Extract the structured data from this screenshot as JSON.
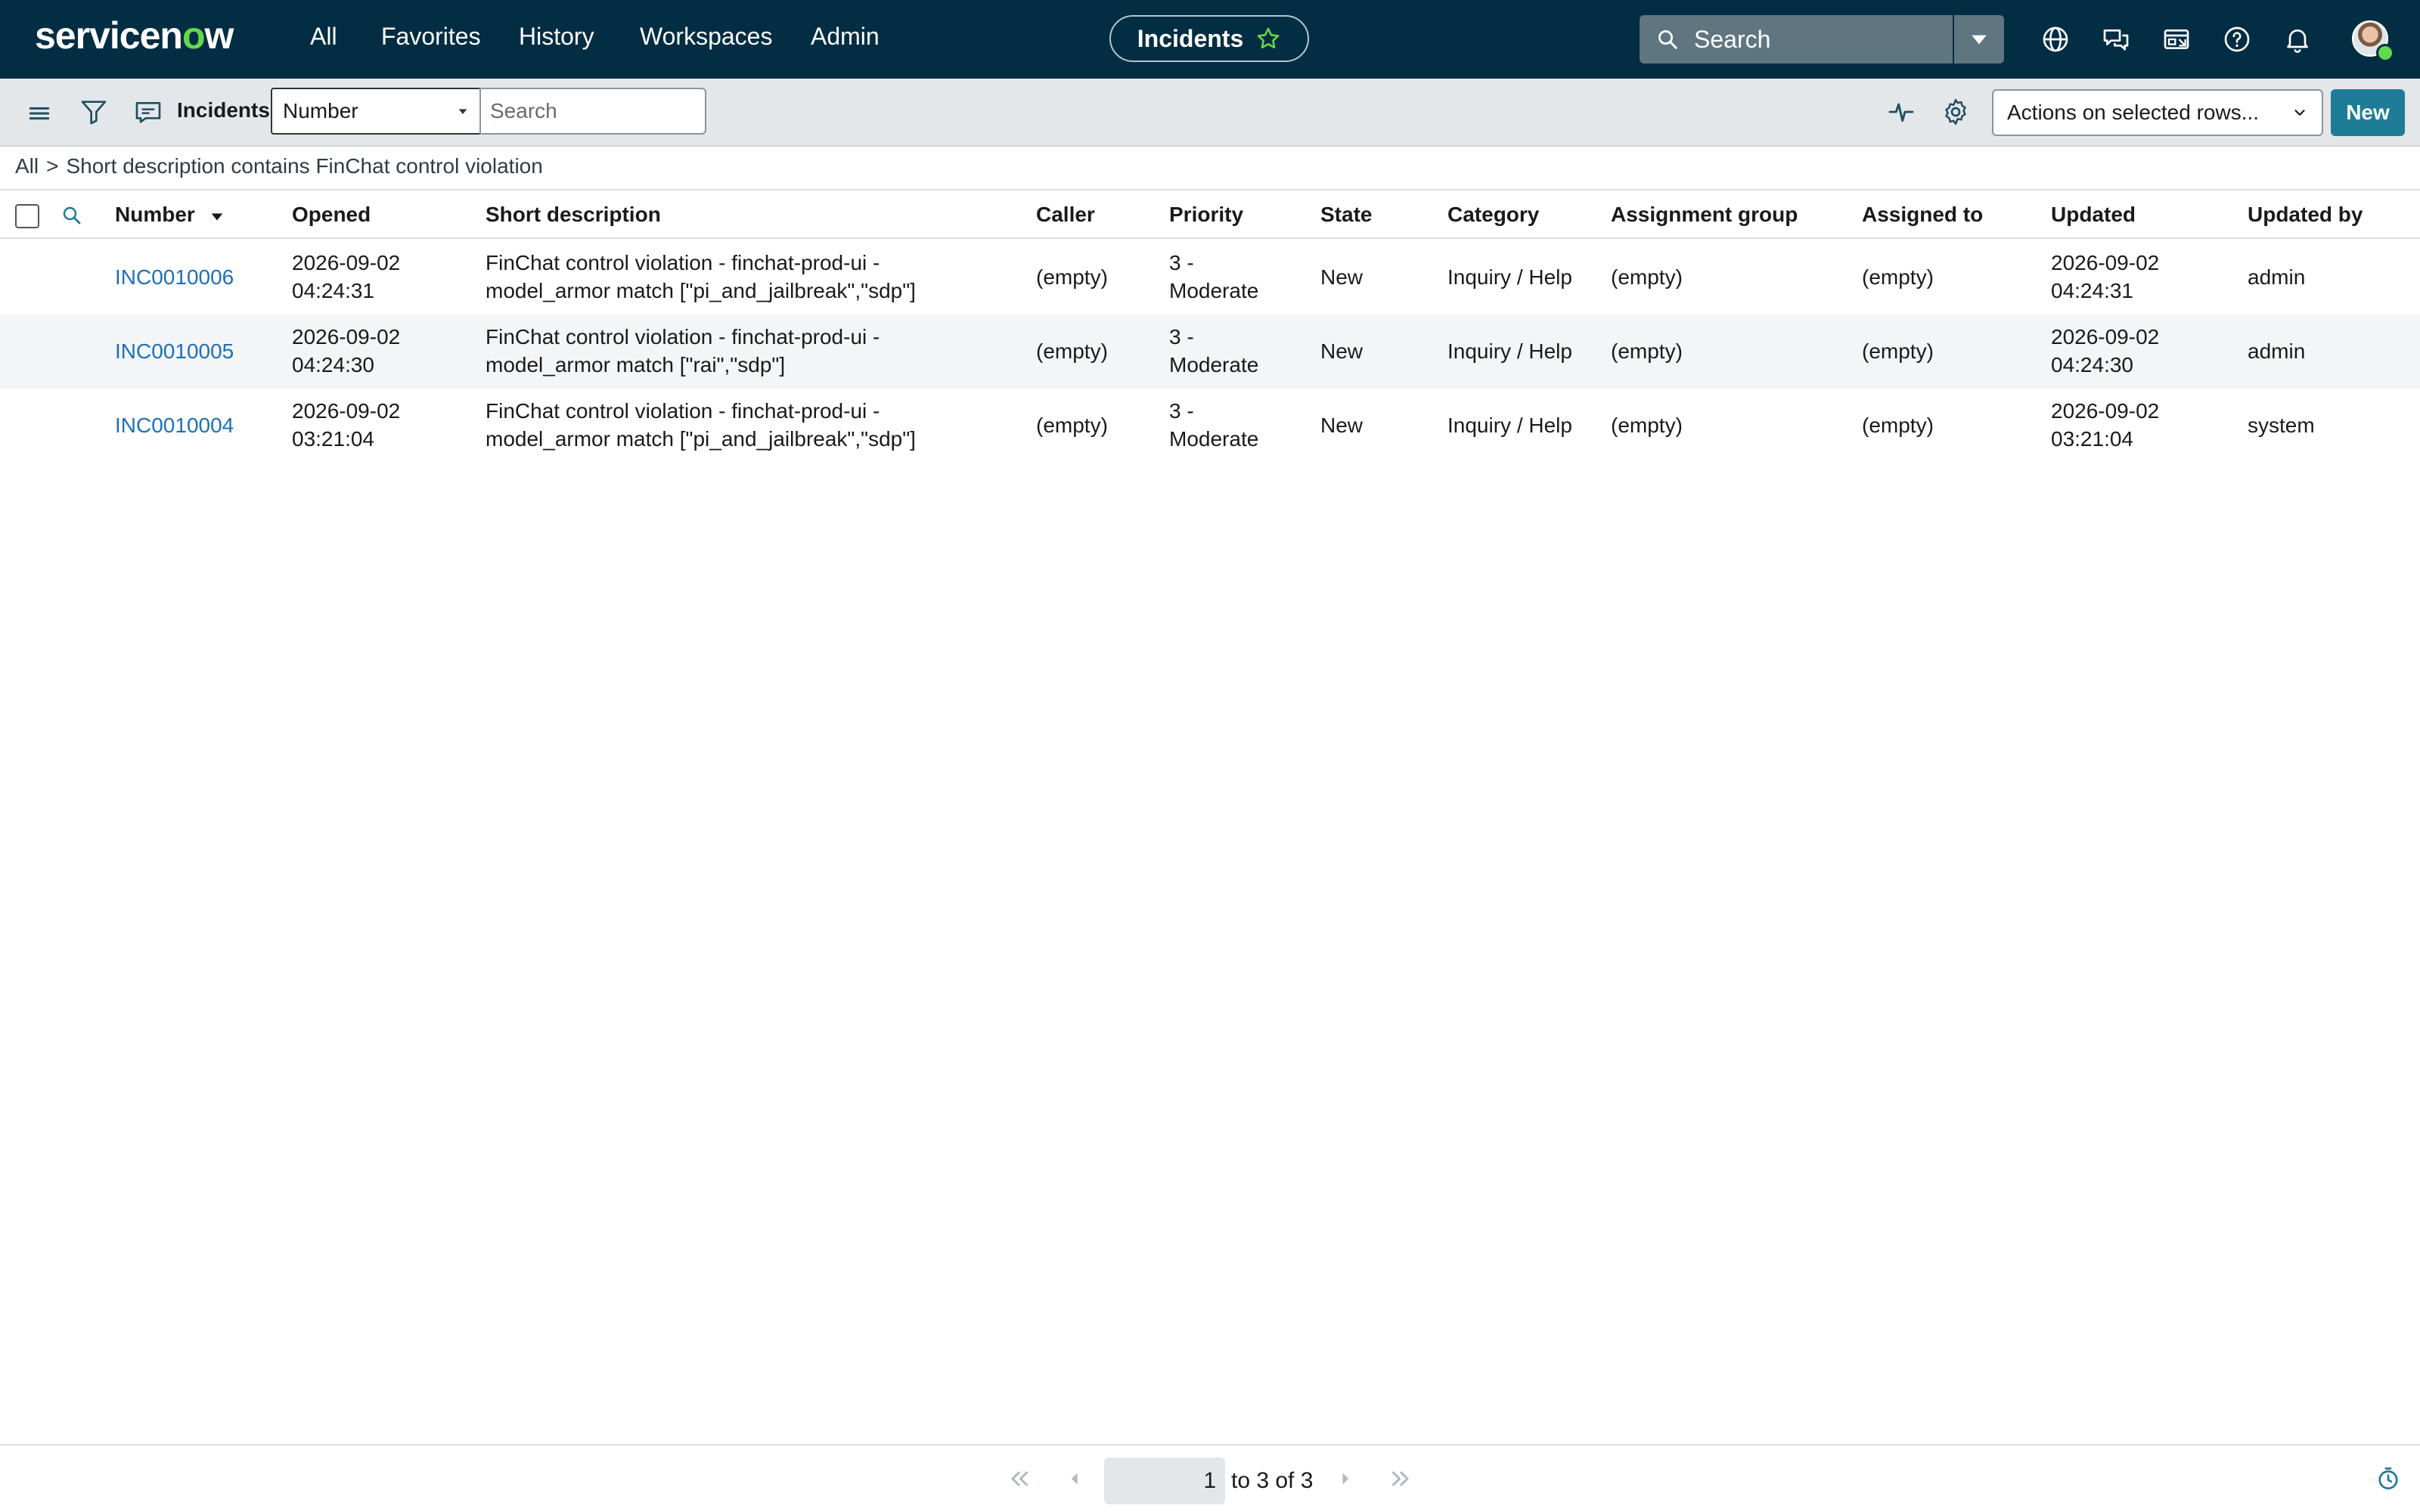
{
  "header": {
    "logo": "servicenow",
    "nav": [
      "All",
      "Favorites",
      "History",
      "Workspaces",
      "Admin"
    ],
    "context_pill": "Incidents",
    "search_placeholder": "Search",
    "avatar_status": "available"
  },
  "toolbar": {
    "list_title": "Incidents",
    "search_field": "Number",
    "search_placeholder": "Search",
    "actions_label": "Actions on selected rows...",
    "new_label": "New"
  },
  "breadcrumb": {
    "root": "All",
    "separator": ">",
    "filter": "Short description contains FinChat control violation"
  },
  "table": {
    "columns": [
      "Number",
      "Opened",
      "Short description",
      "Caller",
      "Priority",
      "State",
      "Category",
      "Assignment group",
      "Assigned to",
      "Updated",
      "Updated by"
    ],
    "sort_column": "Number",
    "sort_direction": "descending",
    "rows": [
      {
        "number": "INC0010006",
        "opened": [
          "2026-09-02",
          "04:24:31"
        ],
        "short_description": [
          "FinChat control violation - finchat-prod-ui -",
          "model_armor match [\"pi_and_jailbreak\",\"sdp\"]"
        ],
        "caller": "(empty)",
        "priority": [
          "3 -",
          "Moderate"
        ],
        "state": "New",
        "category": "Inquiry / Help",
        "assignment_group": "(empty)",
        "assigned_to": "(empty)",
        "updated": [
          "2026-09-02",
          "04:24:31"
        ],
        "updated_by": "admin"
      },
      {
        "number": "INC0010005",
        "opened": [
          "2026-09-02",
          "04:24:30"
        ],
        "short_description": [
          "FinChat control violation - finchat-prod-ui -",
          "model_armor match [\"rai\",\"sdp\"]"
        ],
        "caller": "(empty)",
        "priority": [
          "3 -",
          "Moderate"
        ],
        "state": "New",
        "category": "Inquiry / Help",
        "assignment_group": "(empty)",
        "assigned_to": "(empty)",
        "updated": [
          "2026-09-02",
          "04:24:30"
        ],
        "updated_by": "admin"
      },
      {
        "number": "INC0010004",
        "opened": [
          "2026-09-02",
          "03:21:04"
        ],
        "short_description": [
          "FinChat control violation - finchat-prod-ui -",
          "model_armor match [\"pi_and_jailbreak\",\"sdp\"]"
        ],
        "caller": "(empty)",
        "priority": [
          "3 -",
          "Moderate"
        ],
        "state": "New",
        "category": "Inquiry / Help",
        "assignment_group": "(empty)",
        "assigned_to": "(empty)",
        "updated": [
          "2026-09-02",
          "03:21:04"
        ],
        "updated_by": "system"
      }
    ]
  },
  "pagination": {
    "current": "1",
    "range_text": "to 3 of 3"
  },
  "colors": {
    "header_bg": "#032d42",
    "brand_green": "#62d84e",
    "toolbar_bg": "#e4e7ea",
    "primary_button": "#1f7c96",
    "link": "#1f6fb8",
    "alt_row": "#f4f5f6"
  },
  "icons": {
    "header": [
      "favorite-star-icon",
      "search-icon",
      "caret-down-icon",
      "globe-icon",
      "chat-icon",
      "workspace-icon",
      "help-icon",
      "notifications-bell-icon"
    ],
    "toolbar": [
      "hamburger-menu-icon",
      "filter-icon",
      "list-context-icon",
      "activity-icon",
      "settings-gear-icon"
    ],
    "footer": [
      "first-page-icon",
      "previous-page-icon",
      "next-page-icon",
      "last-page-icon",
      "response-time-icon"
    ]
  }
}
